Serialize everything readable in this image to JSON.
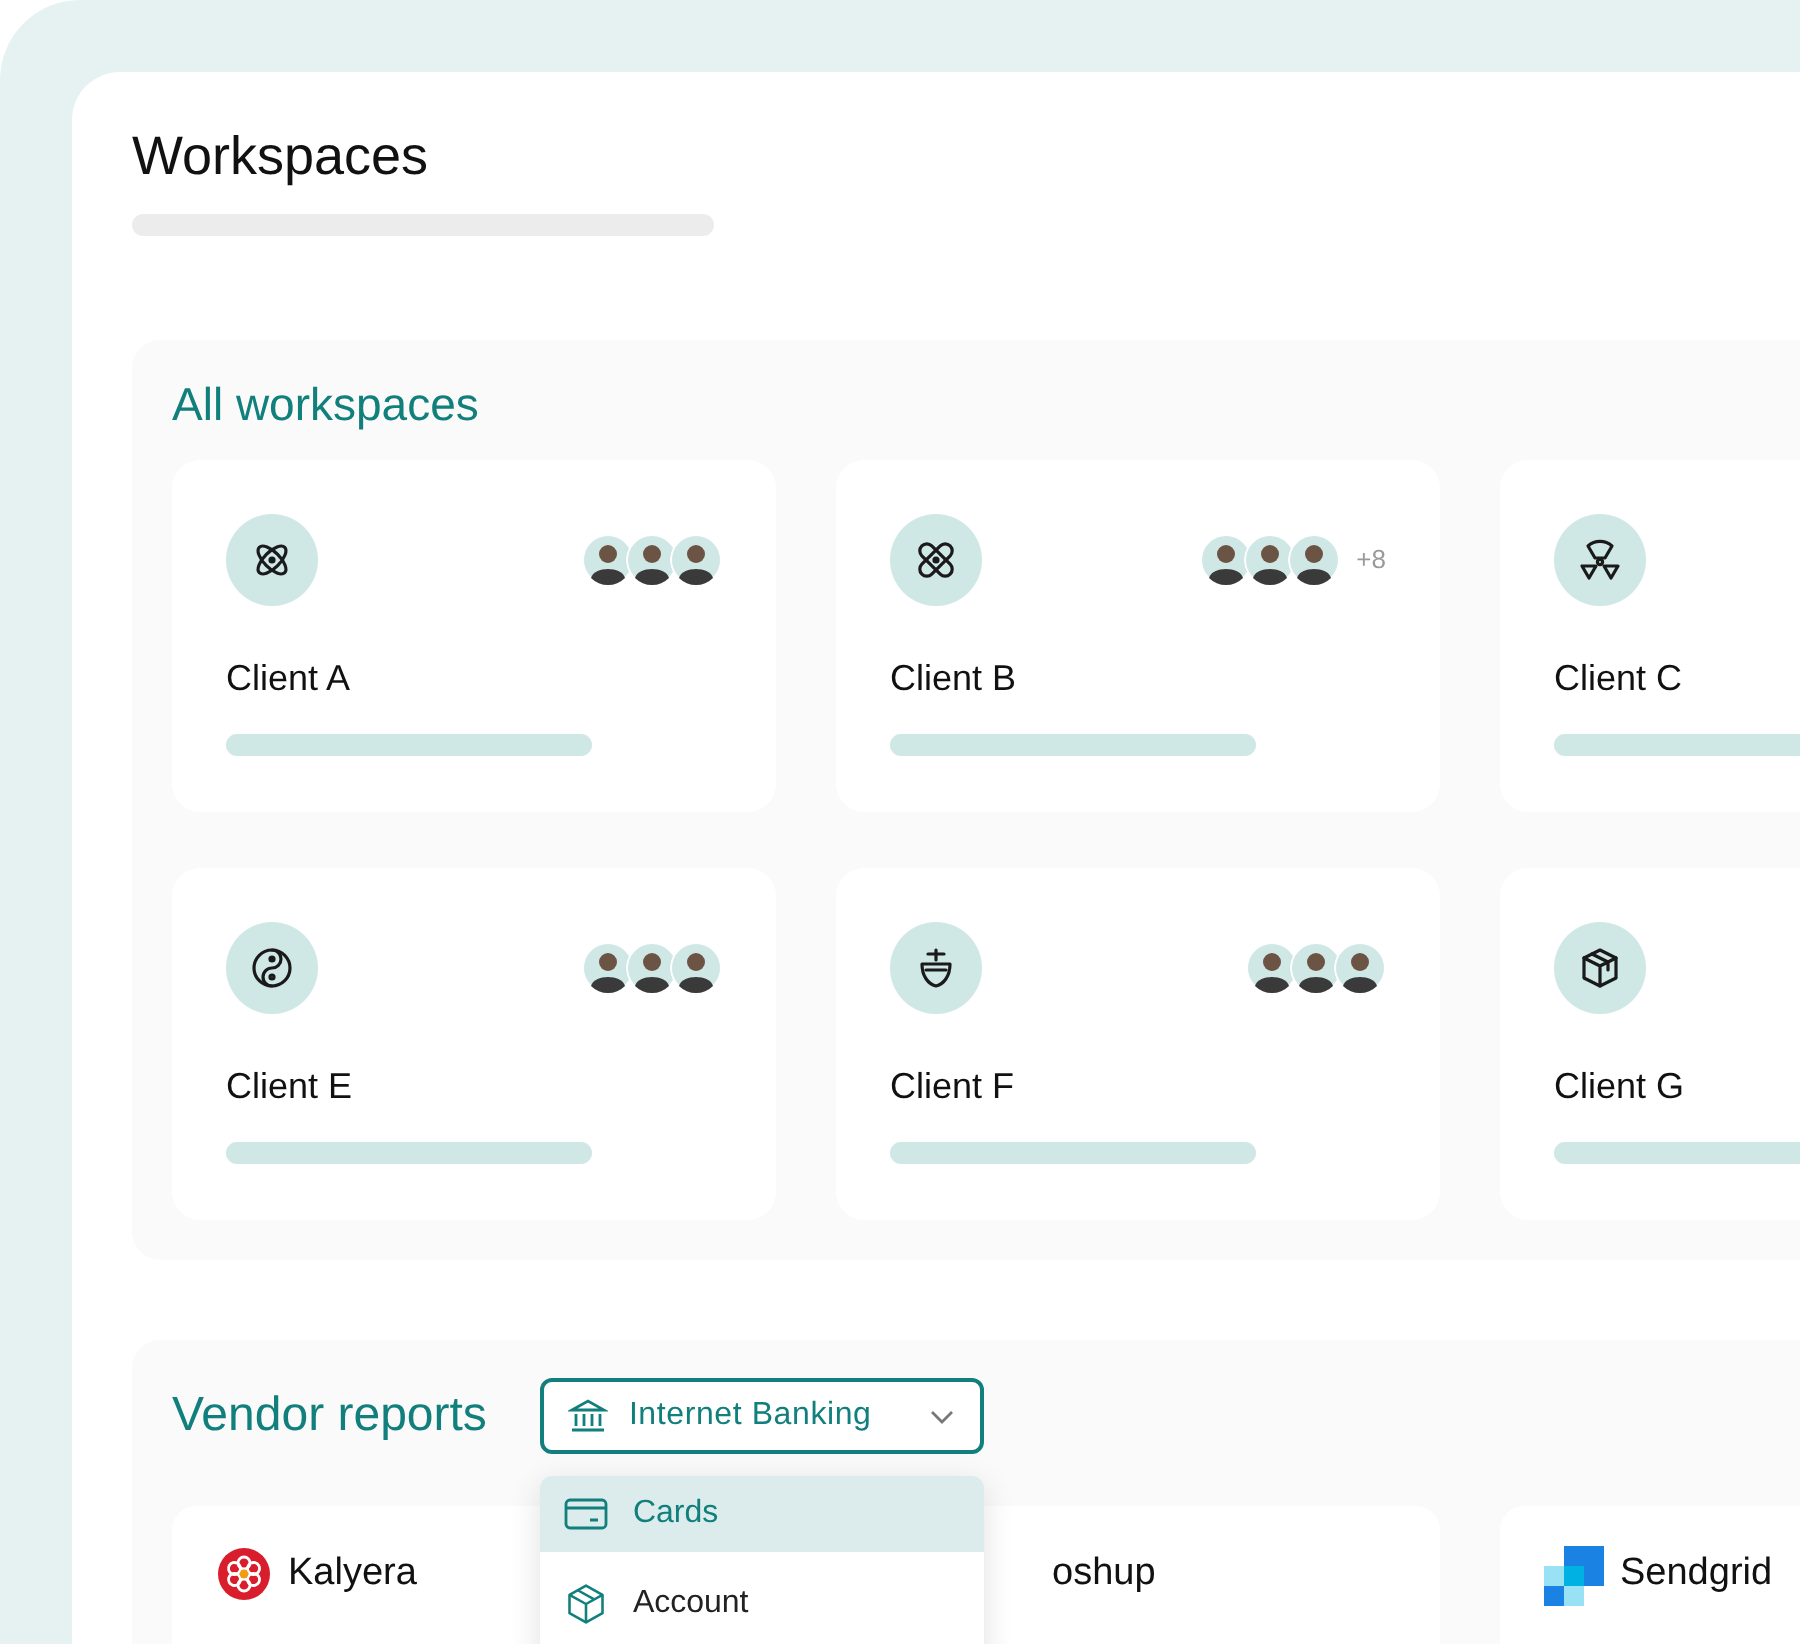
{
  "page": {
    "title": "Workspaces"
  },
  "workspaces": {
    "title": "All workspaces",
    "clients": [
      {
        "name": "Client A",
        "avatars": [
          {
            "kind": "person"
          },
          {
            "kind": "person"
          },
          {
            "kind": "person"
          }
        ]
      },
      {
        "name": "Client B",
        "avatars": [
          {
            "kind": "person"
          },
          {
            "kind": "person"
          },
          {
            "kind": "person"
          }
        ],
        "more": "+8"
      },
      {
        "name": "Client C"
      },
      {
        "name": "Client E",
        "avatars": [
          {
            "kind": "person"
          },
          {
            "kind": "person"
          },
          {
            "kind": "person"
          }
        ]
      },
      {
        "name": "Client F",
        "avatars": [
          {
            "kind": "person"
          },
          {
            "kind": "person"
          },
          {
            "kind": "person"
          }
        ]
      },
      {
        "name": "Client G"
      }
    ]
  },
  "vendor_reports": {
    "title": "Vendor reports",
    "dropdown": {
      "value": "Internet Banking",
      "expanded": true,
      "options": [
        {
          "label": "Cards",
          "selected": true
        },
        {
          "label": "Account",
          "selected": false
        }
      ]
    },
    "vendors": [
      {
        "name": "Kalyera"
      },
      {
        "name": "oshup"
      },
      {
        "name": "Sendgrid"
      }
    ]
  }
}
